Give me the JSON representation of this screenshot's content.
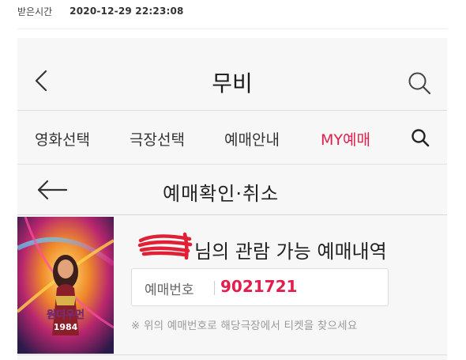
{
  "meta": {
    "label": "받은시간",
    "value": "2020-12-29 22:23:08"
  },
  "app": {
    "title": "무비"
  },
  "nav": {
    "items": [
      "영화선택",
      "극장선택",
      "예매안내",
      "MY예매"
    ]
  },
  "page": {
    "title": "예매확인·취소"
  },
  "booking": {
    "heading_suffix": "님의 관람 가능 예매내역",
    "number_label": "예매번호",
    "number_value": "9021721",
    "notice": "※ 위의 예매번호로 해당극장에서 티켓을 찾으세요"
  },
  "poster": {
    "title_ko": "원더우먼",
    "year": "1984"
  },
  "colors": {
    "accent": "#e21e4c",
    "background": "#f7f7f7"
  }
}
